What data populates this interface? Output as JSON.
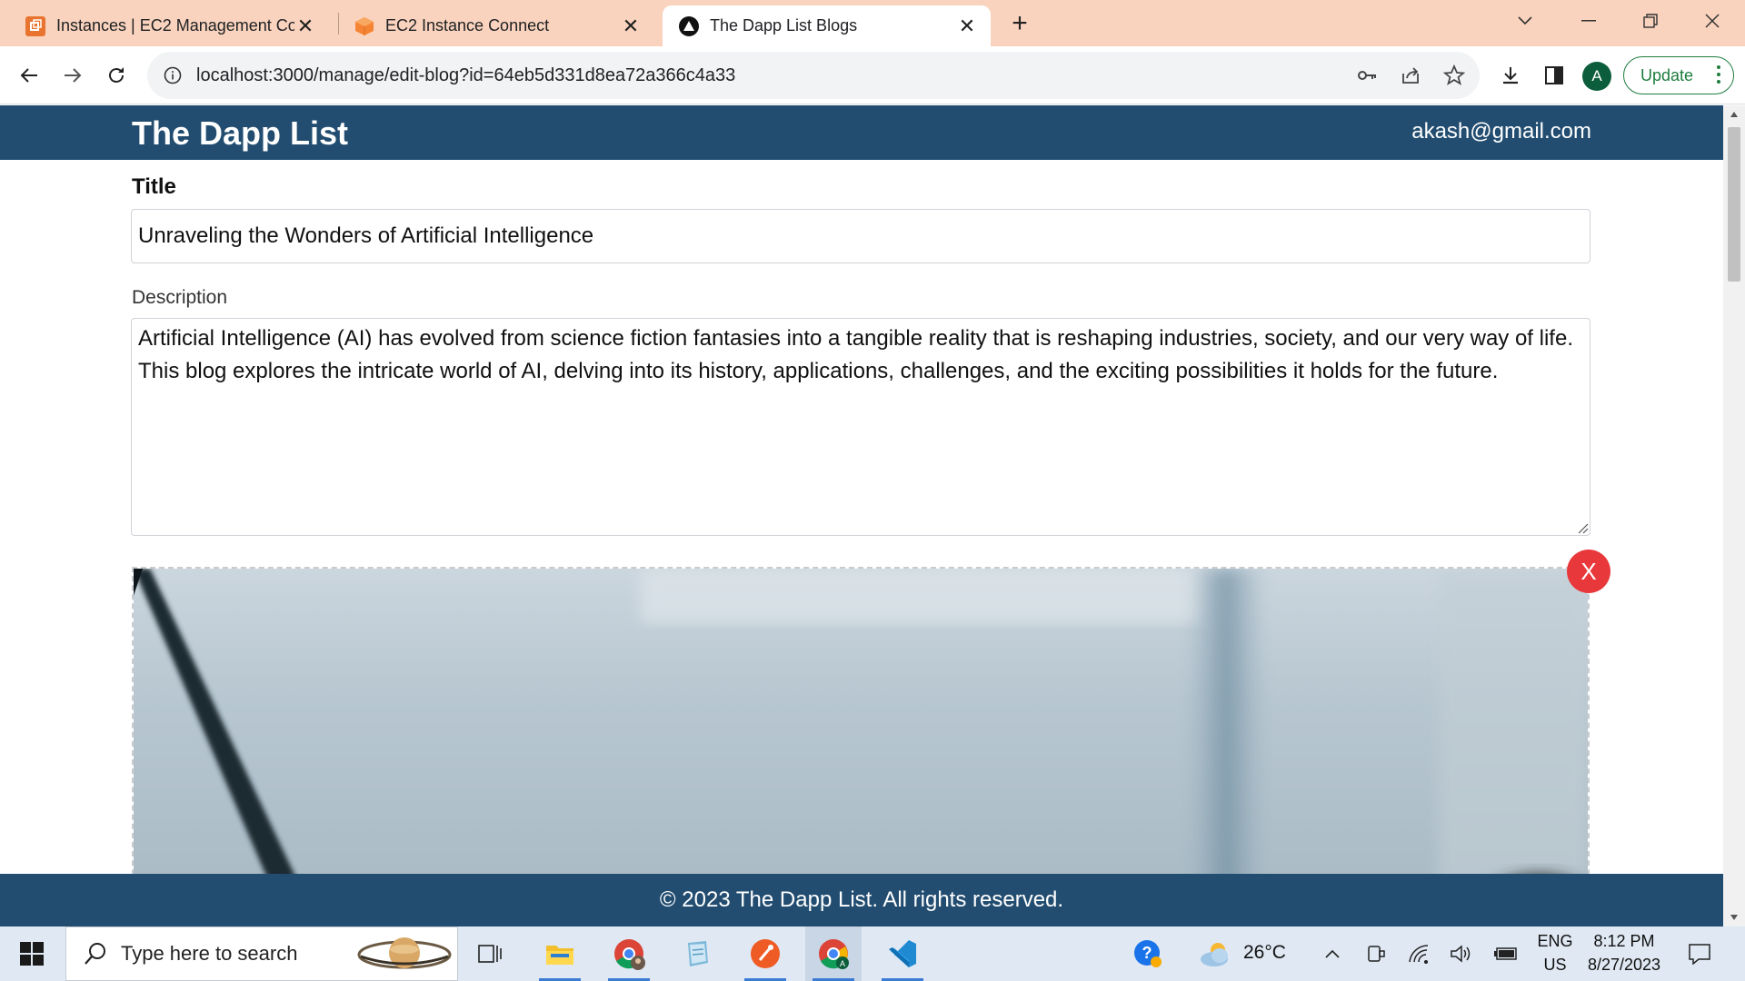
{
  "browser": {
    "tabs": [
      {
        "title": "Instances | EC2 Management Console",
        "favicon": "aws-ec2-icon",
        "active": false
      },
      {
        "title": "EC2 Instance Connect",
        "favicon": "aws-cube-icon",
        "active": false
      },
      {
        "title": "The Dapp List Blogs",
        "favicon": "dapp-triangle-icon",
        "active": true
      }
    ],
    "url": "localhost:3000/manage/edit-blog?id=64eb5d331d8ea72a366c4a33",
    "profile_initial": "A",
    "update_label": "Update"
  },
  "app": {
    "title": "The Dapp List",
    "user_email": "akash@gmail.com",
    "form": {
      "title_label": "Title",
      "title_value": "Unraveling the Wonders of Artificial Intelligence",
      "description_label": "Description",
      "description_value": "Artificial Intelligence (AI) has evolved from science fiction fantasies into a tangible reality that is reshaping industries, society, and our very way of life. This blog explores the intricate world of AI, delving into its history, applications, challenges, and the exciting possibilities it holds for the future.",
      "remove_image_label": "X"
    },
    "footer": "© 2023 The Dapp List. All rights reserved.",
    "colors": {
      "header": "#224d70",
      "remove_button": "#e8383b"
    }
  },
  "taskbar": {
    "search_placeholder": "Type here to search",
    "weather_temp": "26°C",
    "language_line1": "ENG",
    "language_line2": "US",
    "time": "8:12 PM",
    "date": "8/27/2023",
    "apps": [
      "task-view-icon",
      "file-explorer-icon",
      "chrome-profile-icon",
      "notepad-icon",
      "postman-icon",
      "chrome-icon",
      "vscode-icon"
    ]
  }
}
